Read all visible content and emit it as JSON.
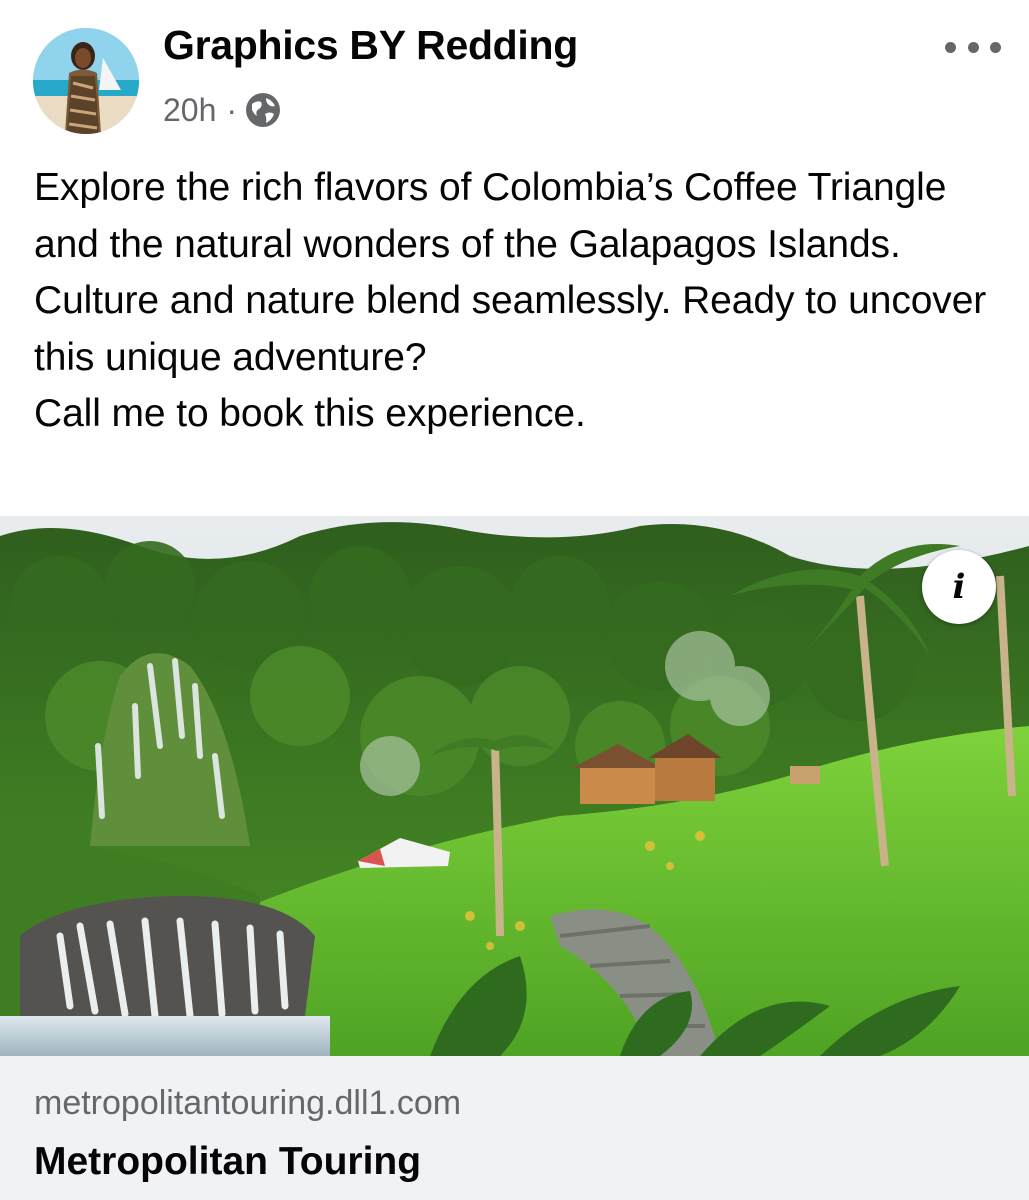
{
  "post": {
    "author": "Graphics BY Redding",
    "time": "20h",
    "separator": "·",
    "privacy_icon": "globe-icon",
    "more_icon": "more-options-icon",
    "body_lines": [
      "Explore the rich flavors of Colombia’s Coffee Triangle and the natural wonders of the Galapagos Islands. Culture and nature blend seamlessly. Ready to uncover this unique adventure?",
      "Call me to book this experience."
    ]
  },
  "media": {
    "info_label": "i",
    "info_icon": "info-icon"
  },
  "link_preview": {
    "domain": "metropolitantouring.dll1.com",
    "title": "Metropolitan Touring"
  },
  "colors": {
    "text_primary": "#050505",
    "text_secondary": "#65676b",
    "card_background": "#f0f2f5"
  }
}
